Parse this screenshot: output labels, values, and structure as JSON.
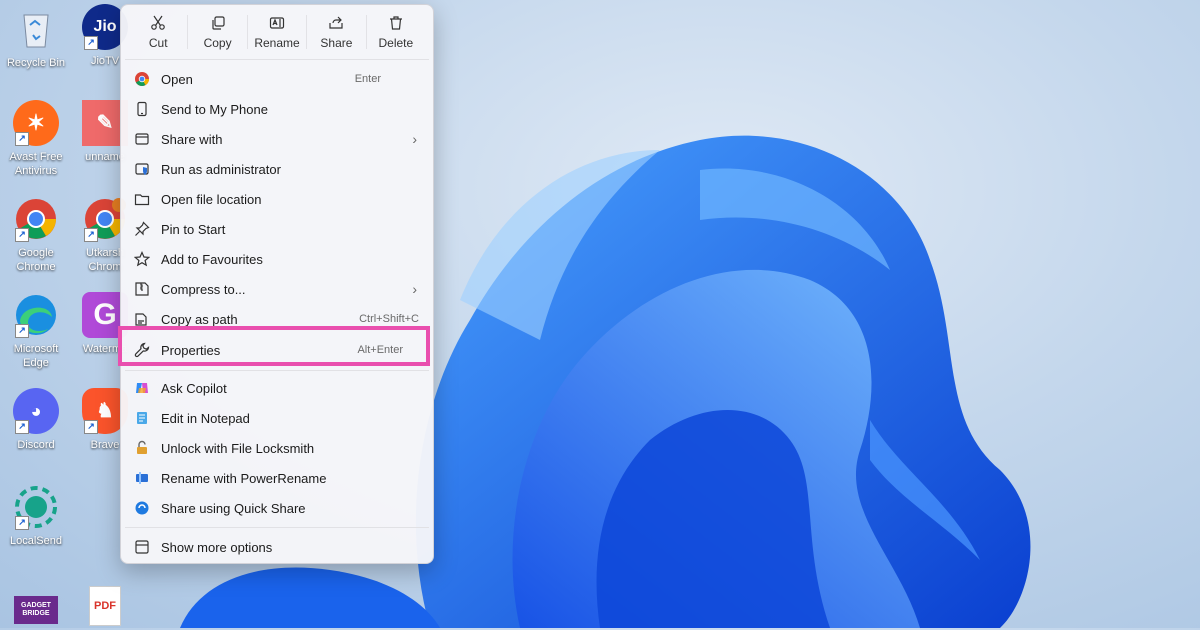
{
  "desktop": {
    "icons": [
      {
        "label": "Recycle Bin",
        "icon": "recycle-bin-icon"
      },
      {
        "label": "JioTV",
        "icon": "jiotv-icon",
        "badge": "Jio"
      },
      {
        "label": "Avast Free Antivirus",
        "icon": "avast-icon"
      },
      {
        "label": "unname",
        "icon": "unnamed-app-icon"
      },
      {
        "label": "Google Chrome",
        "icon": "chrome-icon"
      },
      {
        "label": "Utkarsh Chrom",
        "icon": "chrome-profile-icon"
      },
      {
        "label": "Microsoft Edge",
        "icon": "edge-icon"
      },
      {
        "label": "Waterma",
        "icon": "watermark-app-icon",
        "badge": "G"
      },
      {
        "label": "Discord",
        "icon": "discord-icon"
      },
      {
        "label": "Brave",
        "icon": "brave-icon"
      },
      {
        "label": "LocalSend",
        "icon": "localsend-icon"
      },
      {
        "label": "",
        "icon": "gadgets-bridge-icon",
        "badge": "GADGET BRIDGE"
      },
      {
        "label": "",
        "icon": "pdf-file-icon",
        "badge": "PDF"
      }
    ]
  },
  "context_menu": {
    "toolbar": [
      {
        "label": "Cut",
        "icon": "scissors-icon"
      },
      {
        "label": "Copy",
        "icon": "copy-icon"
      },
      {
        "label": "Rename",
        "icon": "rename-icon"
      },
      {
        "label": "Share",
        "icon": "share-icon"
      },
      {
        "label": "Delete",
        "icon": "trash-icon"
      }
    ],
    "items": [
      {
        "label": "Open",
        "shortcut": "Enter",
        "icon": "chrome-icon"
      },
      {
        "label": "Send to My Phone",
        "icon": "phone-icon"
      },
      {
        "label": "Share with",
        "icon": "share-with-icon",
        "submenu": "›"
      },
      {
        "label": "Run as administrator",
        "icon": "shield-icon"
      },
      {
        "label": "Open file location",
        "icon": "folder-icon"
      },
      {
        "label": "Pin to Start",
        "icon": "pin-icon"
      },
      {
        "label": "Add to Favourites",
        "icon": "star-icon"
      },
      {
        "label": "Compress to...",
        "icon": "archive-icon",
        "submenu": "›"
      },
      {
        "label": "Copy as path",
        "shortcut": "Ctrl+Shift+C",
        "icon": "path-icon"
      },
      {
        "label": "Properties",
        "shortcut": "Alt+Enter",
        "icon": "wrench-icon"
      }
    ],
    "extra_items": [
      {
        "label": "Ask Copilot",
        "icon": "copilot-icon"
      },
      {
        "label": "Edit in Notepad",
        "icon": "notepad-icon"
      },
      {
        "label": "Unlock with File Locksmith",
        "icon": "lock-icon"
      },
      {
        "label": "Rename with PowerRename",
        "icon": "powerrename-icon"
      },
      {
        "label": "Share using Quick Share",
        "icon": "quick-share-icon"
      }
    ],
    "more": {
      "label": "Show more options",
      "icon": "more-options-icon"
    },
    "highlight_color": "#e94fae"
  }
}
